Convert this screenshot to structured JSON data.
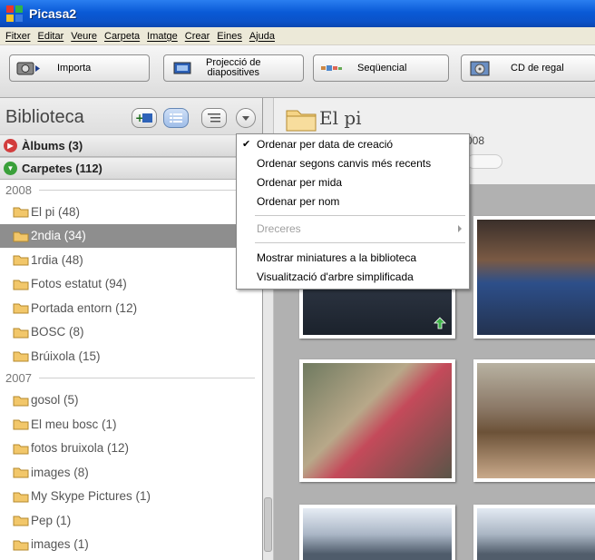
{
  "window": {
    "title": "Picasa2"
  },
  "menubar": [
    "Fitxer",
    "Editar",
    "Veure",
    "Carpeta",
    "Imatge",
    "Crear",
    "Eines",
    "Ajuda"
  ],
  "toolbar": {
    "import": "Importa",
    "slideshow_1": "Projecció de",
    "slideshow_2": "diapositives",
    "timeline": "Seqüencial",
    "gift_cd": "CD de regal"
  },
  "sidebar": {
    "title": "Biblioteca",
    "albums": "Àlbums (3)",
    "folders": "Carpetes (112)",
    "year_2008": "2008",
    "items_2008": [
      "El pi (48)",
      "2ndia (34)",
      "1rdia (48)",
      "Fotos estatut (94)",
      "Portada entorn (12)",
      "BOSC (8)",
      "Brúixola (15)"
    ],
    "year_2007": "2007",
    "items_2007": [
      "gosol (5)",
      "El meu bosc (1)",
      "fotos bruixola (12)",
      "images (8)",
      "My Skype Pictures (1)",
      "Pep (1)",
      "images (1)"
    ]
  },
  "main": {
    "folder_title": "El pi",
    "date_fragment": "008"
  },
  "context_menu": {
    "items": [
      "Ordenar per data de creació",
      "Ordenar segons canvis més recents",
      "Ordenar per mida",
      "Ordenar per nom",
      "Dreceres",
      "Mostrar miniatures a la biblioteca",
      "Visualització d'arbre simplificada"
    ]
  }
}
